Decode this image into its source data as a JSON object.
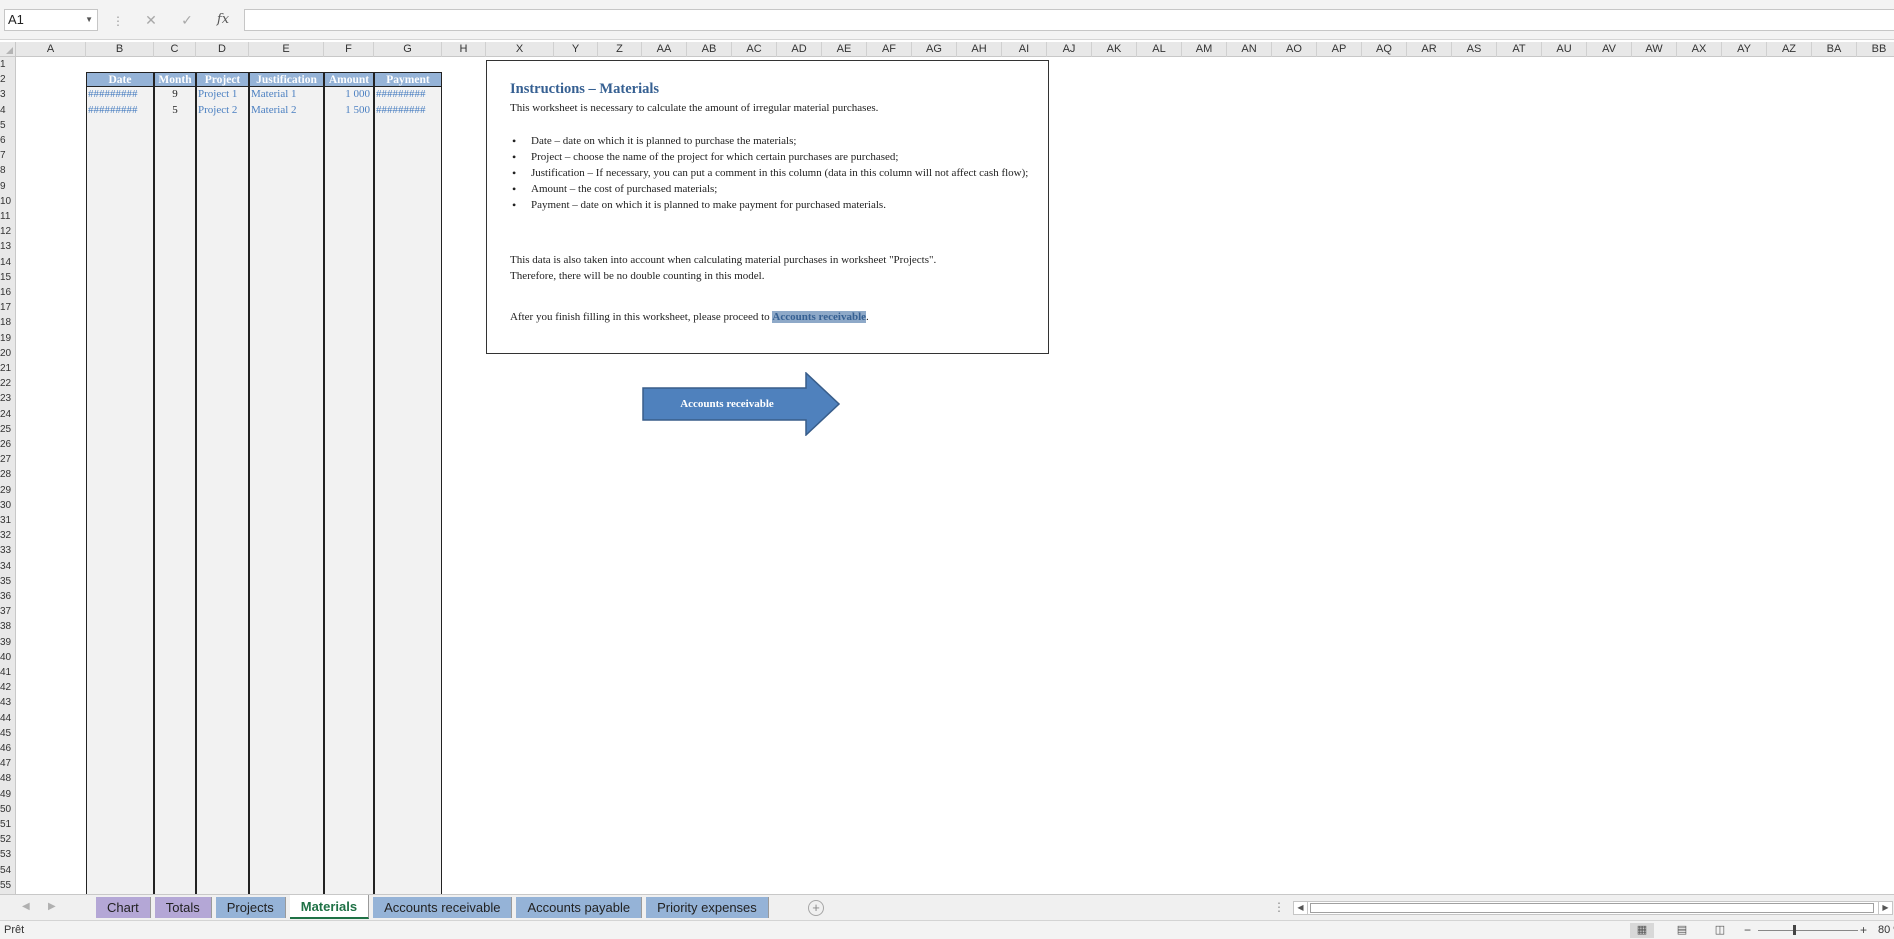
{
  "formula_bar": {
    "name_box": "A1",
    "cancel_icon": "close-icon",
    "enter_icon": "check-icon",
    "fx_label": "fx",
    "formula": ""
  },
  "columns": [
    "A",
    "B",
    "C",
    "D",
    "E",
    "F",
    "G",
    "H",
    "X",
    "Y",
    "Z",
    "AA",
    "AB",
    "AC",
    "AD",
    "AE",
    "AF",
    "AG",
    "AH",
    "AI",
    "AJ",
    "AK",
    "AL",
    "AM",
    "AN",
    "AO",
    "AP",
    "AQ",
    "AR",
    "AS",
    "AT",
    "AU",
    "AV",
    "AW",
    "AX",
    "AY",
    "AZ",
    "BA",
    "BB"
  ],
  "rows": [
    "1",
    "2",
    "3",
    "4",
    "5",
    "6",
    "7",
    "8",
    "9",
    "10",
    "11",
    "12",
    "13",
    "14",
    "15",
    "16",
    "17",
    "18",
    "19",
    "20",
    "21",
    "22",
    "23",
    "24",
    "25",
    "26",
    "27",
    "28",
    "29",
    "30",
    "31",
    "32",
    "33",
    "34",
    "35",
    "36",
    "37",
    "38",
    "39",
    "40",
    "41",
    "42",
    "43",
    "44",
    "45",
    "46",
    "47",
    "48",
    "49",
    "50",
    "51",
    "52",
    "53",
    "54",
    "55"
  ],
  "table": {
    "headers": [
      "Date",
      "Month",
      "Project",
      "Justification",
      "Amount",
      "Payment"
    ],
    "rows": [
      {
        "date": "#########",
        "month": "9",
        "project": "Project 1",
        "justification": "Material 1",
        "amount": "1 000",
        "payment": "#########"
      },
      {
        "date": "#########",
        "month": "5",
        "project": "Project 2",
        "justification": "Material 2",
        "amount": "1 500",
        "payment": "#########"
      }
    ]
  },
  "instructions": {
    "title": "Instructions – Materials",
    "intro": "This worksheet is necessary to calculate the amount of irregular material purchases.",
    "bullets": [
      "Date – date on which it is planned to purchase the materials;",
      "Project – choose the name of the project for which certain purchases are purchased;",
      "Justification – If necessary, you can put a comment in this column (data in this column will not affect cash flow);",
      "Amount – the cost of purchased materials;",
      "Payment – date on which it is planned to make payment for purchased materials."
    ],
    "note_line1": "This data is also taken into account when calculating material purchases in worksheet \"Projects\".",
    "note_line2": "Therefore, there will be no double counting in this model.",
    "final_prefix": "After you finish filling in this worksheet, please proceed to ",
    "final_link": "Accounts receivable",
    "final_suffix": "."
  },
  "arrow_button": {
    "label": "Accounts receivable",
    "fill_color": "#4f81bd",
    "border_color": "#385d8a"
  },
  "sheet_tabs": [
    {
      "label": "Chart",
      "color": "#b4a7d6",
      "active": false
    },
    {
      "label": "Totals",
      "color": "#b4a7d6",
      "active": false
    },
    {
      "label": "Projects",
      "color": "#95b3d7",
      "active": false
    },
    {
      "label": "Materials",
      "color": "#ffffff",
      "active": true
    },
    {
      "label": "Accounts receivable",
      "color": "#95b3d7",
      "active": false
    },
    {
      "label": "Accounts payable",
      "color": "#95b3d7",
      "active": false
    },
    {
      "label": "Priority expenses",
      "color": "#95b3d7",
      "active": false
    }
  ],
  "status_bar": {
    "status": "Prêt",
    "zoom": "80 %"
  }
}
